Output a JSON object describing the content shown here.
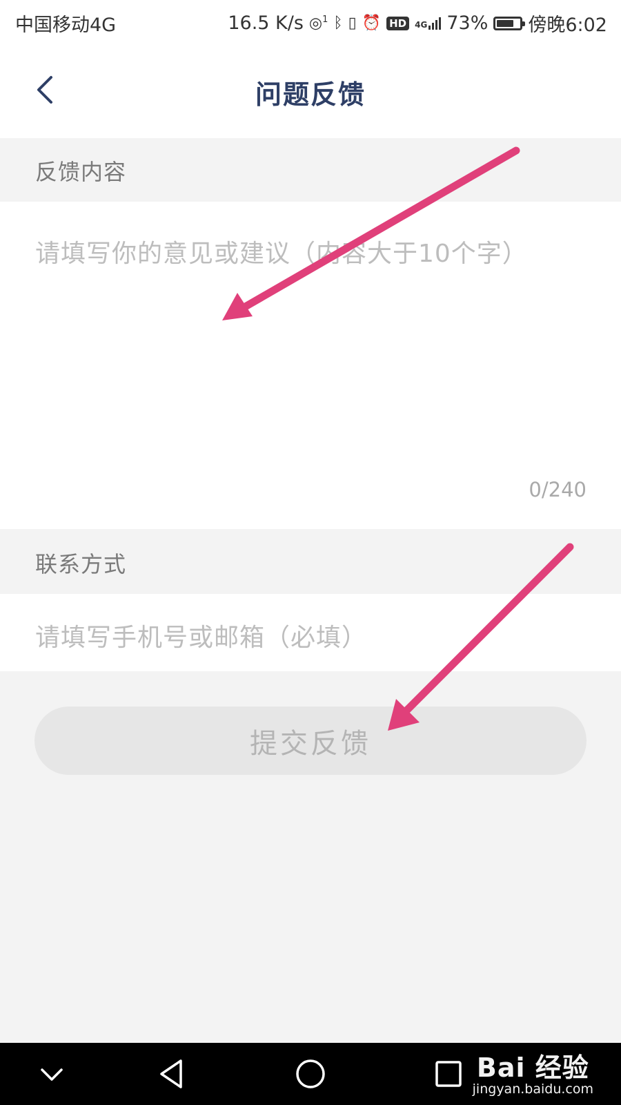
{
  "status_bar": {
    "carrier": "中国移动4G",
    "net_speed": "16.5 K/s",
    "hotspot_sup": "1",
    "network_type": "4G",
    "hd_badge": "HD",
    "battery_percent": "73%",
    "battery_level": 0.73,
    "time": "傍晚6:02",
    "icons": [
      "hotspot-icon",
      "bluetooth-icon",
      "vibrate-icon",
      "alarm-icon",
      "hd-icon",
      "signal-icon",
      "battery-icon"
    ]
  },
  "header": {
    "title": "问题反馈",
    "back_icon": "chevron-left-icon"
  },
  "feedback": {
    "section_label": "反馈内容",
    "placeholder": "请填写你的意见或建议（内容大于10个字）",
    "counter": "0/240"
  },
  "contact": {
    "section_label": "联系方式",
    "placeholder": "请填写手机号或邮箱（必填）"
  },
  "submit": {
    "label": "提交反馈"
  },
  "annotation_color": "#e0407a",
  "system_nav": {
    "icons": [
      "chevron-down-icon",
      "back-triangle-icon",
      "home-circle-icon",
      "recents-square-icon"
    ]
  },
  "watermark": {
    "brand": "Bai 经验",
    "domain": "jingyan.baidu.com"
  },
  "colors": {
    "title": "#2e3f66",
    "background": "#f3f3f3",
    "placeholder": "#bdbdbd",
    "button_disabled": "#e6e6e6"
  }
}
